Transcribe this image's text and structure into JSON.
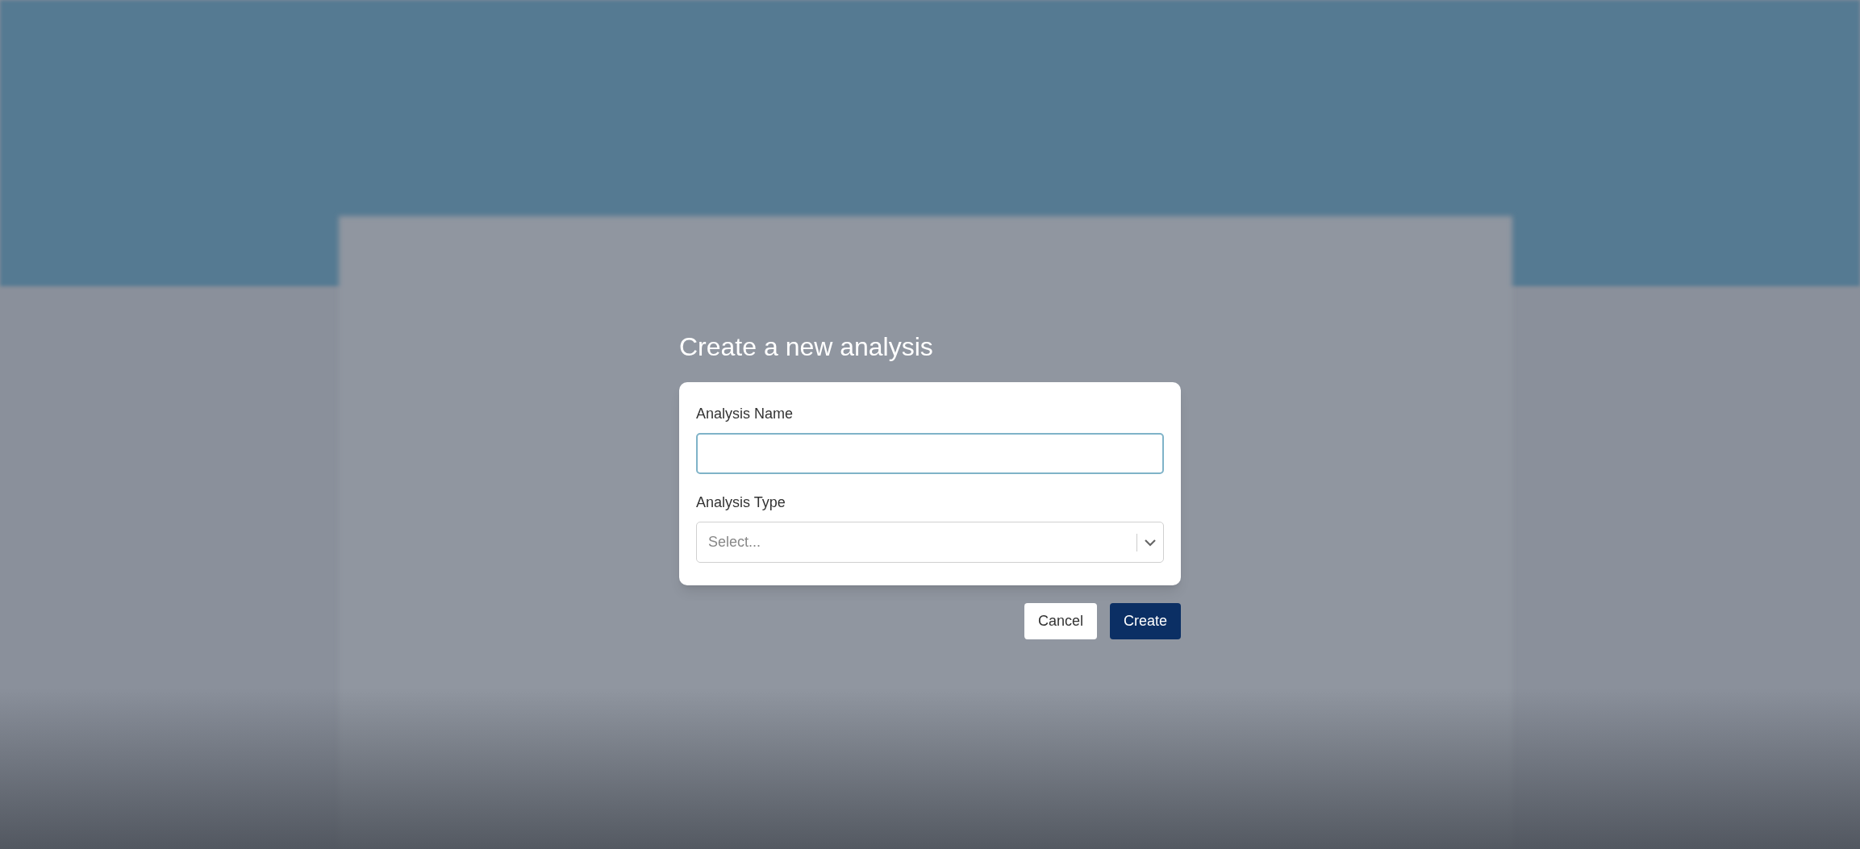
{
  "dialog": {
    "title": "Create a new analysis",
    "fields": [
      {
        "kind": "text",
        "label": "Analysis Name"
      },
      {
        "kind": "select",
        "label": "Analysis Type",
        "placeholder": "Select..."
      }
    ],
    "buttons": [
      {
        "label": "Cancel",
        "primary": false
      },
      {
        "label": "Create",
        "primary": true
      }
    ]
  }
}
